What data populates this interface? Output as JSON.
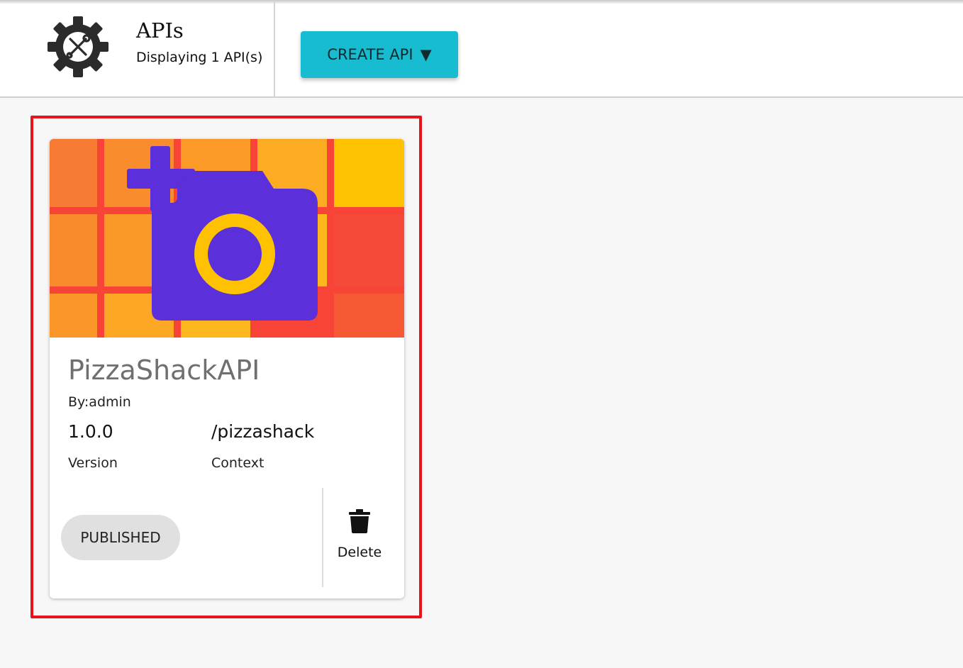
{
  "header": {
    "title": "APIs",
    "subtitle": "Displaying 1 API(s)",
    "create_button": {
      "label": "CREATE API",
      "caret": "▼"
    }
  },
  "api_card": {
    "name": "PizzaShackAPI",
    "owner": "By:admin",
    "version": "1.0.0",
    "version_label": "Version",
    "context": "/pizzashack",
    "context_label": "Context",
    "status": "PUBLISHED",
    "delete_label": "Delete",
    "thumbnail_icon": "add-a-photo-icon"
  },
  "colors": {
    "accent_button": "#17bcd0",
    "highlight_frame": "#e8141a",
    "thumbnail_icon": "#5b2fd9"
  }
}
